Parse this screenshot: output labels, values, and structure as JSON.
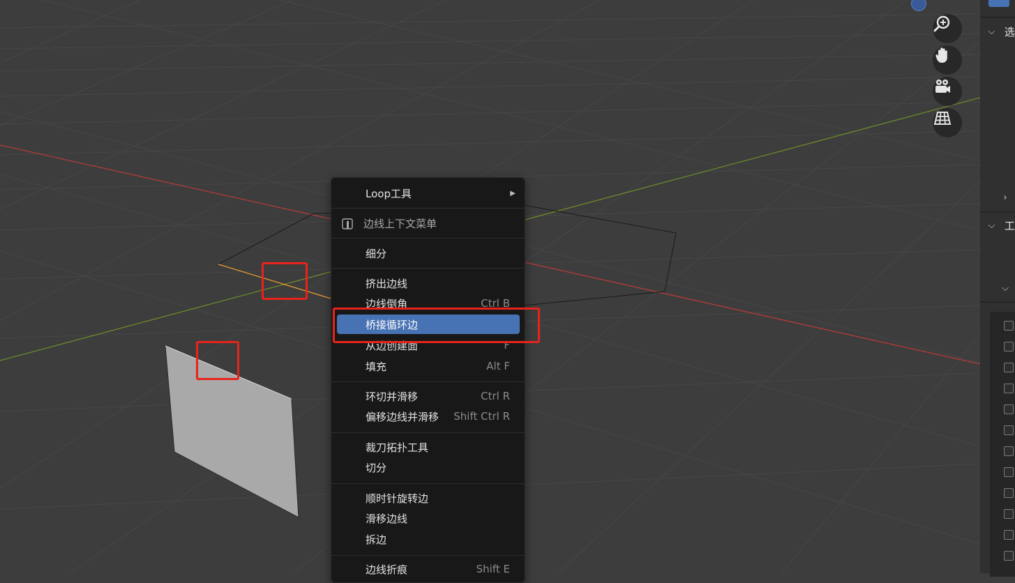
{
  "colors": {
    "background": "#3d3d3d",
    "grid": "#4a4a4a",
    "axis_x": "#b53b3b",
    "axis_y": "#6b8a2a",
    "selected_edge": "#f0a030",
    "menu_bg": "#181818",
    "menu_active": "#4772b3",
    "highlight": "#e8231c",
    "plane_fill": "#a9a9a9"
  },
  "nav_gizmo": {
    "buttons": [
      {
        "name": "zoom",
        "icon": "zoom-icon"
      },
      {
        "name": "pan",
        "icon": "hand-icon"
      },
      {
        "name": "camera",
        "icon": "camera-icon"
      },
      {
        "name": "ortho",
        "icon": "grid-view-icon"
      }
    ]
  },
  "sidebar": {
    "sections": [
      {
        "title": "选项"
      },
      {
        "title": "工具"
      }
    ]
  },
  "context_menu": {
    "groups": [
      [
        {
          "label": "Loop工具",
          "shortcut": "",
          "submenu": true
        }
      ],
      [
        {
          "label": "边线上下文菜单",
          "shortcut": "",
          "header": true
        }
      ],
      [
        {
          "label": "细分",
          "shortcut": ""
        }
      ],
      [
        {
          "label": "挤出边线",
          "shortcut": ""
        },
        {
          "label": "边线倒角",
          "shortcut": "Ctrl B"
        },
        {
          "label": "桥接循环边",
          "shortcut": "",
          "active": true
        },
        {
          "label": "从边创建面",
          "shortcut": "F"
        },
        {
          "label": "填充",
          "shortcut": "Alt F"
        }
      ],
      [
        {
          "label": "环切并滑移",
          "shortcut": "Ctrl R"
        },
        {
          "label": "偏移边线并滑移",
          "shortcut": "Shift Ctrl R"
        }
      ],
      [
        {
          "label": "裁刀拓扑工具",
          "shortcut": ""
        },
        {
          "label": "切分",
          "shortcut": ""
        }
      ],
      [
        {
          "label": "顺时针旋转边",
          "shortcut": ""
        },
        {
          "label": "滑移边线",
          "shortcut": ""
        },
        {
          "label": "拆边",
          "shortcut": ""
        }
      ],
      [
        {
          "label": "边线折痕",
          "shortcut": "Shift E"
        }
      ]
    ]
  }
}
